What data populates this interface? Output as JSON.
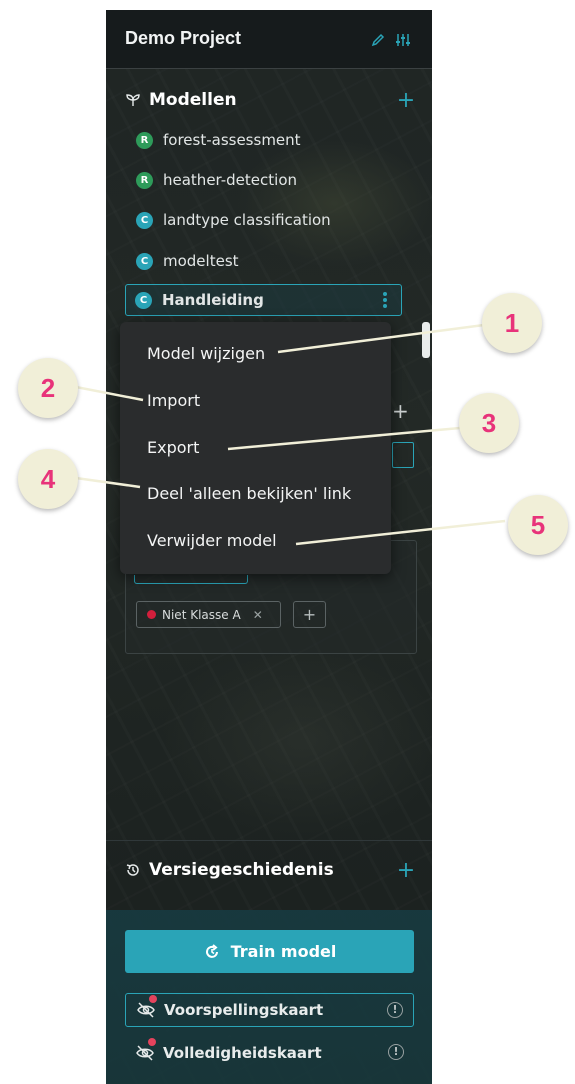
{
  "project": {
    "title": "Demo Project"
  },
  "models_section": {
    "title": "Modellen",
    "items": [
      {
        "badge": "R",
        "badge_color": "#2e9b5a",
        "label": "forest-assessment"
      },
      {
        "badge": "R",
        "badge_color": "#2e9b5a",
        "label": "heather-detection"
      },
      {
        "badge": "C",
        "badge_color": "#2aa4b7",
        "label": "landtype classification"
      },
      {
        "badge": "C",
        "badge_color": "#2aa4b7",
        "label": "modeltest"
      },
      {
        "badge": "C",
        "badge_color": "#2aa4b7",
        "label": "Handleiding",
        "selected": true
      }
    ]
  },
  "context_menu": {
    "items": [
      {
        "label": "Model wijzigen",
        "callout": "1"
      },
      {
        "label": "Import",
        "callout": "2"
      },
      {
        "label": "Export",
        "callout": "3"
      },
      {
        "label": "Deel 'alleen bekijken' link",
        "callout": "4"
      },
      {
        "label": "Verwijder model",
        "callout": "5"
      }
    ]
  },
  "class_chip": {
    "label": "Niet Klasse A",
    "dot_color": "#d21f3c"
  },
  "history_section": {
    "title": "Versiegeschiedenis"
  },
  "train_button": {
    "label": "Train model"
  },
  "map_toggles": [
    {
      "label": "Voorspellingskaart",
      "active": true
    },
    {
      "label": "Volledigheidskaart",
      "active": false
    }
  ],
  "colors": {
    "accent": "#2aa4b7",
    "callout_fill": "#f1efd8",
    "callout_text": "#e8337a"
  }
}
